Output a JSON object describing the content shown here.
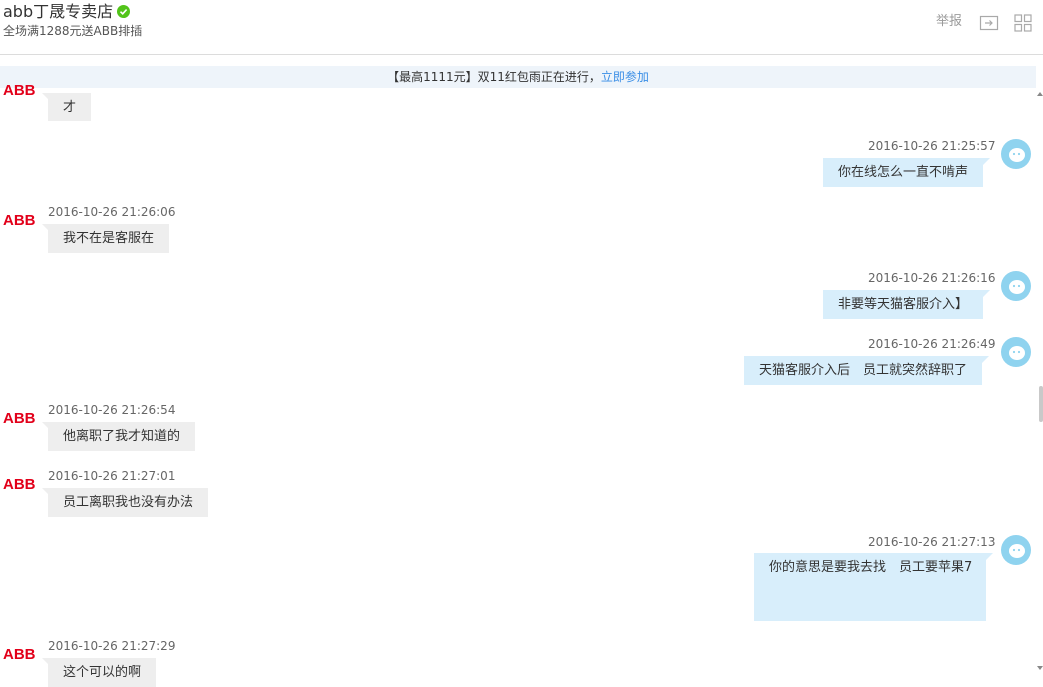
{
  "header": {
    "shop_name": "abb丁晟专卖店",
    "promo": "全场满1288元送ABB排插",
    "report_label": "举报"
  },
  "banner": {
    "text": "【最高1111元】双11红包雨正在进行，",
    "link": "立即参加"
  },
  "colors": {
    "accent": "#3a8ee6",
    "verified": "#52c41a",
    "abb_red": "#e2001a",
    "cat_avatar": "#8fd3ef",
    "bubble_left": "#eeeeee",
    "bubble_right": "#d8eefb"
  },
  "icons": {
    "verified": "check-circle-icon",
    "share": "share-box-icon",
    "grid": "grid-icon",
    "seller_avatar": "abb-logo-icon",
    "buyer_avatar": "cat-avatar-icon"
  },
  "messages": [
    {
      "side": "left",
      "time": "",
      "text": "才"
    },
    {
      "side": "right",
      "time": "2016-10-26 21:25:57",
      "text": "你在线怎么一直不啃声"
    },
    {
      "side": "left",
      "time": "2016-10-26 21:26:06",
      "text": "我不在是客服在"
    },
    {
      "side": "right",
      "time": "2016-10-26 21:26:16",
      "text": "非要等天猫客服介入】"
    },
    {
      "side": "right",
      "time": "2016-10-26 21:26:49",
      "text": "天猫客服介入后　员工就突然辞职了"
    },
    {
      "side": "left",
      "time": "2016-10-26 21:26:54",
      "text": "他离职了我才知道的"
    },
    {
      "side": "left",
      "time": "2016-10-26 21:27:01",
      "text": "员工离职我也没有办法"
    },
    {
      "side": "right",
      "time": "2016-10-26 21:27:13",
      "text": "你的意思是要我去找　员工要苹果7"
    },
    {
      "side": "left",
      "time": "2016-10-26 21:27:29",
      "text": "这个可以的啊"
    }
  ]
}
